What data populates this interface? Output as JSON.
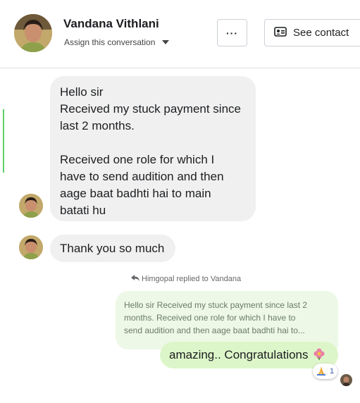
{
  "header": {
    "contact_name": "Vandana Vithlani",
    "assign_label": "Assign this conversation",
    "more_label": "···",
    "see_contact_label": "See contact"
  },
  "messages": {
    "incoming_1": {
      "lines_a": [
        "Hello sir",
        "Received my stuck payment since",
        "last 2 months."
      ],
      "lines_b": [
        "Received one role for which I",
        "have to send audition and then",
        "aage baat badhti hai to main",
        "batati hu"
      ]
    },
    "incoming_2": {
      "text": "Thank you so much"
    },
    "reply_context": {
      "label": "Himgopal replied to Vandana"
    },
    "quoted": {
      "lines": [
        "Hello sir Received my stuck payment since last 2",
        "months. Received one role for which I have to",
        "send audition and then aage baat badhti hai to..."
      ]
    },
    "outgoing": {
      "text": "amazing.. Congratulations"
    },
    "reaction": {
      "emoji": "🙏",
      "count": "1"
    }
  },
  "colors": {
    "incoming_bubble": "#f0f0f0",
    "outgoing_bubble": "#ddf6c9",
    "quote_bubble": "#edf8e6",
    "active_bar": "#5fd06a"
  },
  "icons": [
    "caret-down-icon",
    "contact-card-icon",
    "reply-arrow-icon",
    "flower-icon",
    "prayer-hands-icon"
  ]
}
